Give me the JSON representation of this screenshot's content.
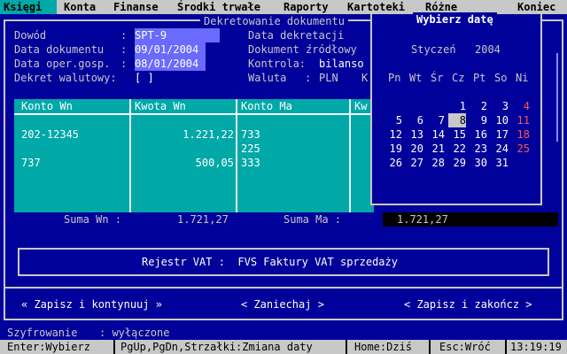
{
  "menu": {
    "items": [
      "Księgi",
      "Konta",
      "Finanse",
      "Środki trwałe",
      "Raporty",
      "Kartoteki",
      "Różne"
    ],
    "exit": "Koniec"
  },
  "window": {
    "title": "Dekretowanie dokumentu"
  },
  "form": {
    "dowod_label": "Dowód",
    "dowod_value": "SPT-9",
    "data_dok_label": "Data dokumentu",
    "data_dok_value": "09/01/2004",
    "data_oper_label": "Data oper.gosp.",
    "data_oper_value": "08/01/2004",
    "dekret_label": "Dekret walutowy:",
    "dekret_value": "[ ]",
    "data_dekr_label": "Data dekretacji",
    "dok_zrod_label": "Dokument źródłowy",
    "kontrola_label": "Kontrola:",
    "kontrola_value": "bilanso",
    "waluta_label": "Waluta",
    "waluta_value": "PLN",
    "waluta_extra": "K"
  },
  "table": {
    "headers": [
      "Konto Wn",
      "Kwota Wn",
      "Konto Ma",
      "Kw"
    ],
    "rows": [
      {
        "konto_wn": "202-12345",
        "kwota_wn": "1.221,22",
        "konto_ma": "733"
      },
      {
        "konto_wn": "",
        "kwota_wn": "",
        "konto_ma": "225"
      },
      {
        "konto_wn": "737",
        "kwota_wn": "500,05",
        "konto_ma": "333"
      }
    ]
  },
  "sums": {
    "wn_label": "Suma Wn :",
    "wn_value": "1.721,27",
    "ma_label": "Suma Ma :",
    "ma_value": "1.721,27"
  },
  "vat": {
    "text": "Rejestr VAT :  FVS Faktury VAT sprzedaży"
  },
  "buttons": {
    "save_continue": "« Zapisz i kontynuuj »",
    "cancel": "< Zaniechaj >",
    "save_finish": "< Zapisz i zakończ >"
  },
  "datepicker": {
    "title": "Wybierz datę",
    "month": "Styczeń",
    "year": "2004",
    "weekdays": [
      "Pn",
      "Wt",
      "Śr",
      "Cz",
      "Pt",
      "So",
      "Ni"
    ],
    "weeks": [
      [
        "",
        "",
        "",
        "1",
        "2",
        "3",
        "4"
      ],
      [
        "5",
        "6",
        "7",
        "8",
        "9",
        "10",
        "11"
      ],
      [
        "12",
        "13",
        "14",
        "15",
        "16",
        "17",
        "18"
      ],
      [
        "19",
        "20",
        "21",
        "22",
        "23",
        "24",
        "25"
      ],
      [
        "26",
        "27",
        "28",
        "29",
        "30",
        "31",
        ""
      ]
    ],
    "selected": "8"
  },
  "status": {
    "label": "Szyfrowanie",
    "value": ": wyłączone"
  },
  "hints": {
    "enter": "Enter:Wybierz",
    "pgup": "PgUp,PgDn,Strzałki:Zmiana daty",
    "home": "Home:Dziś",
    "esc": "Esc:Wróć",
    "time": "13:19:19"
  },
  "colors": {
    "background": "#00009a",
    "table": "#00a8a8",
    "sunday": "#ff5555",
    "bar": "#c8c8c8"
  }
}
